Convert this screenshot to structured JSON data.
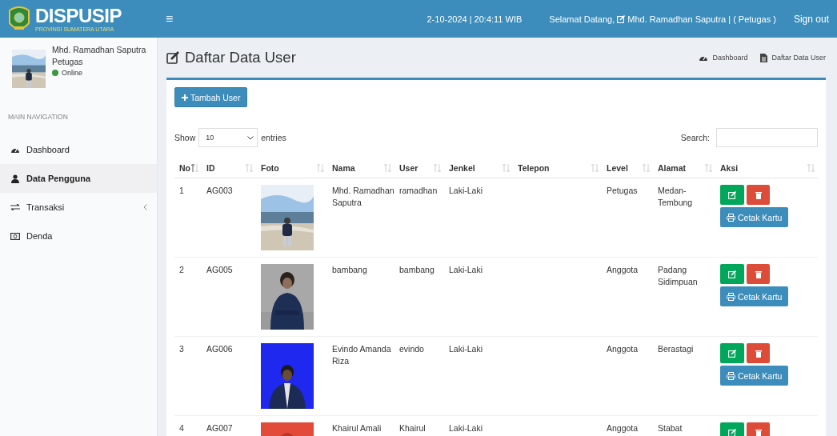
{
  "header": {
    "brand": "DISPUSIP",
    "subtitle": "PROVINSI SUMATERA UTARA",
    "menu_toggle": "≡",
    "datetime": "2-10-2024 | 20:4:11 WIB",
    "welcome": "Selamat Datang,",
    "user": "Mhd. Ramadhan Saputra | ( Petugas )",
    "signout": "Sign out"
  },
  "user_panel": {
    "name": "Mhd. Ramadhan Saputra",
    "role": "Petugas",
    "status": "Online",
    "color": "#3c9a3c"
  },
  "sidebar": {
    "heading": "MAIN NAVIGATION",
    "items": [
      {
        "label": "Dashboard",
        "kind": "dashboard",
        "selected": false,
        "expandable": false
      },
      {
        "label": "Data Pengguna",
        "kind": "user",
        "selected": true,
        "expandable": false
      },
      {
        "label": "Transaksi",
        "kind": "exchange",
        "selected": false,
        "expandable": true
      },
      {
        "label": "Denda",
        "kind": "money",
        "selected": false,
        "expandable": false
      }
    ]
  },
  "page": {
    "title": "Daftar Data User",
    "breadcrumb": [
      {
        "label": "Dashboard",
        "kind": "dashboard"
      },
      {
        "label": "Daftar Data User",
        "kind": "file"
      }
    ]
  },
  "add_button": "Tambah User",
  "length": {
    "prefix": "Show",
    "value": "10",
    "suffix": "entries"
  },
  "search": {
    "label": "Search:"
  },
  "table": {
    "columns": [
      {
        "label": "No",
        "sorted": true
      },
      {
        "label": "ID",
        "sorted": false
      },
      {
        "label": "Foto",
        "sorted": false
      },
      {
        "label": "Nama",
        "sorted": false
      },
      {
        "label": "User",
        "sorted": false
      },
      {
        "label": "Jenkel",
        "sorted": false
      },
      {
        "label": "Telepon",
        "sorted": false
      },
      {
        "label": "Level",
        "sorted": false
      },
      {
        "label": "Alamat",
        "sorted": false
      },
      {
        "label": "Aksi",
        "sorted": false
      }
    ],
    "rows": [
      {
        "no": "1",
        "id": "AG003",
        "nama": "Mhd. Ramadhan Saputra",
        "user": "ramadhan",
        "jenkel": "Laki-Laki",
        "level": "Petugas",
        "alamat": "Medan-Tembung",
        "print": "Cetak Kartu"
      },
      {
        "no": "2",
        "id": "AG005",
        "nama": "bambang",
        "user": "bambang",
        "jenkel": "Laki-Laki",
        "level": "Anggota",
        "alamat": "Padang Sidimpuan",
        "print": "Cetak Kartu"
      },
      {
        "no": "3",
        "id": "AG006",
        "nama": "Evindo Amanda Riza",
        "user": "evindo",
        "jenkel": "Laki-Laki",
        "level": "Anggota",
        "alamat": "Berastagi",
        "print": "Cetak Kartu"
      },
      {
        "no": "4",
        "id": "AG007",
        "nama": "Khairul Amali",
        "user": "Khairul",
        "jenkel": "Laki-Laki",
        "level": "Anggota",
        "alamat": "Stabat"
      }
    ]
  }
}
